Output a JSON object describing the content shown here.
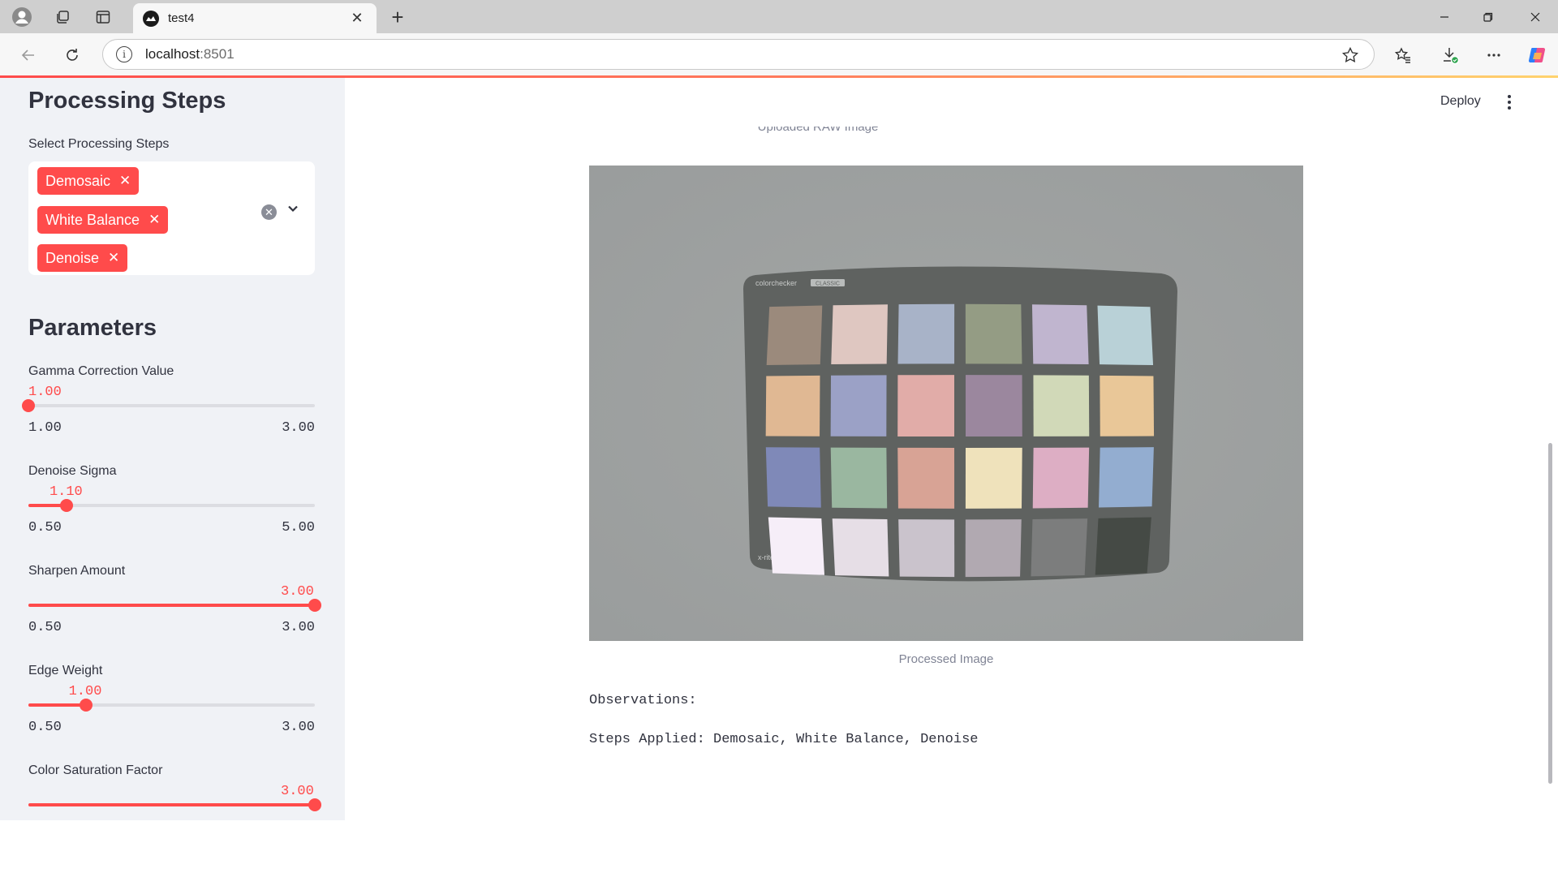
{
  "browser": {
    "tab_title": "test4",
    "url_host": "localhost",
    "url_port": ":8501"
  },
  "sidebar": {
    "processing_heading": "Processing Steps",
    "select_label": "Select Processing Steps",
    "selected_steps": [
      "Demosaic",
      "White Balance",
      "Denoise"
    ],
    "parameters_heading": "Parameters",
    "sliders": [
      {
        "label": "Gamma Correction Value",
        "value": "1.00",
        "min": "1.00",
        "max": "3.00",
        "fraction": 0.0
      },
      {
        "label": "Denoise Sigma",
        "value": "1.10",
        "min": "0.50",
        "max": "5.00",
        "fraction": 0.133
      },
      {
        "label": "Sharpen Amount",
        "value": "3.00",
        "min": "0.50",
        "max": "3.00",
        "fraction": 1.0
      },
      {
        "label": "Edge Weight",
        "value": "1.00",
        "min": "0.50",
        "max": "3.00",
        "fraction": 0.2
      },
      {
        "label": "Color Saturation Factor",
        "value": "3.00",
        "min": "",
        "max": "",
        "fraction": 1.0
      }
    ]
  },
  "main": {
    "deploy_label": "Deploy",
    "uploaded_caption": "Uploaded RAW Image",
    "processed_caption": "Processed Image",
    "observations_label": "Observations:",
    "steps_applied": "Steps Applied: Demosaic, White Balance, Denoise",
    "chart_brand": "colorchecker",
    "chart_brand_tag": "CLASSIC",
    "chart_maker": "x-rite",
    "patches": [
      [
        "#9b8a7c",
        "#dfc7c1",
        "#a8b3c8",
        "#949c84",
        "#c0b5cf",
        "#b9d1d7"
      ],
      [
        "#e0b893",
        "#9ba1c6",
        "#e1aca8",
        "#9b879e",
        "#d1d9b8",
        "#e9c798"
      ],
      [
        "#7f89b8",
        "#9ab7a0",
        "#d8a395",
        "#efe2bb",
        "#ddaec4",
        "#93add0"
      ],
      [
        "#f6eef8",
        "#e6dee6",
        "#cac3cc",
        "#b1a9b1",
        "#7c7d7d",
        "#454a45"
      ]
    ]
  },
  "colors": {
    "accent": "#ff4b4b",
    "sidebar_bg": "#f0f2f6",
    "text": "#31333f"
  }
}
